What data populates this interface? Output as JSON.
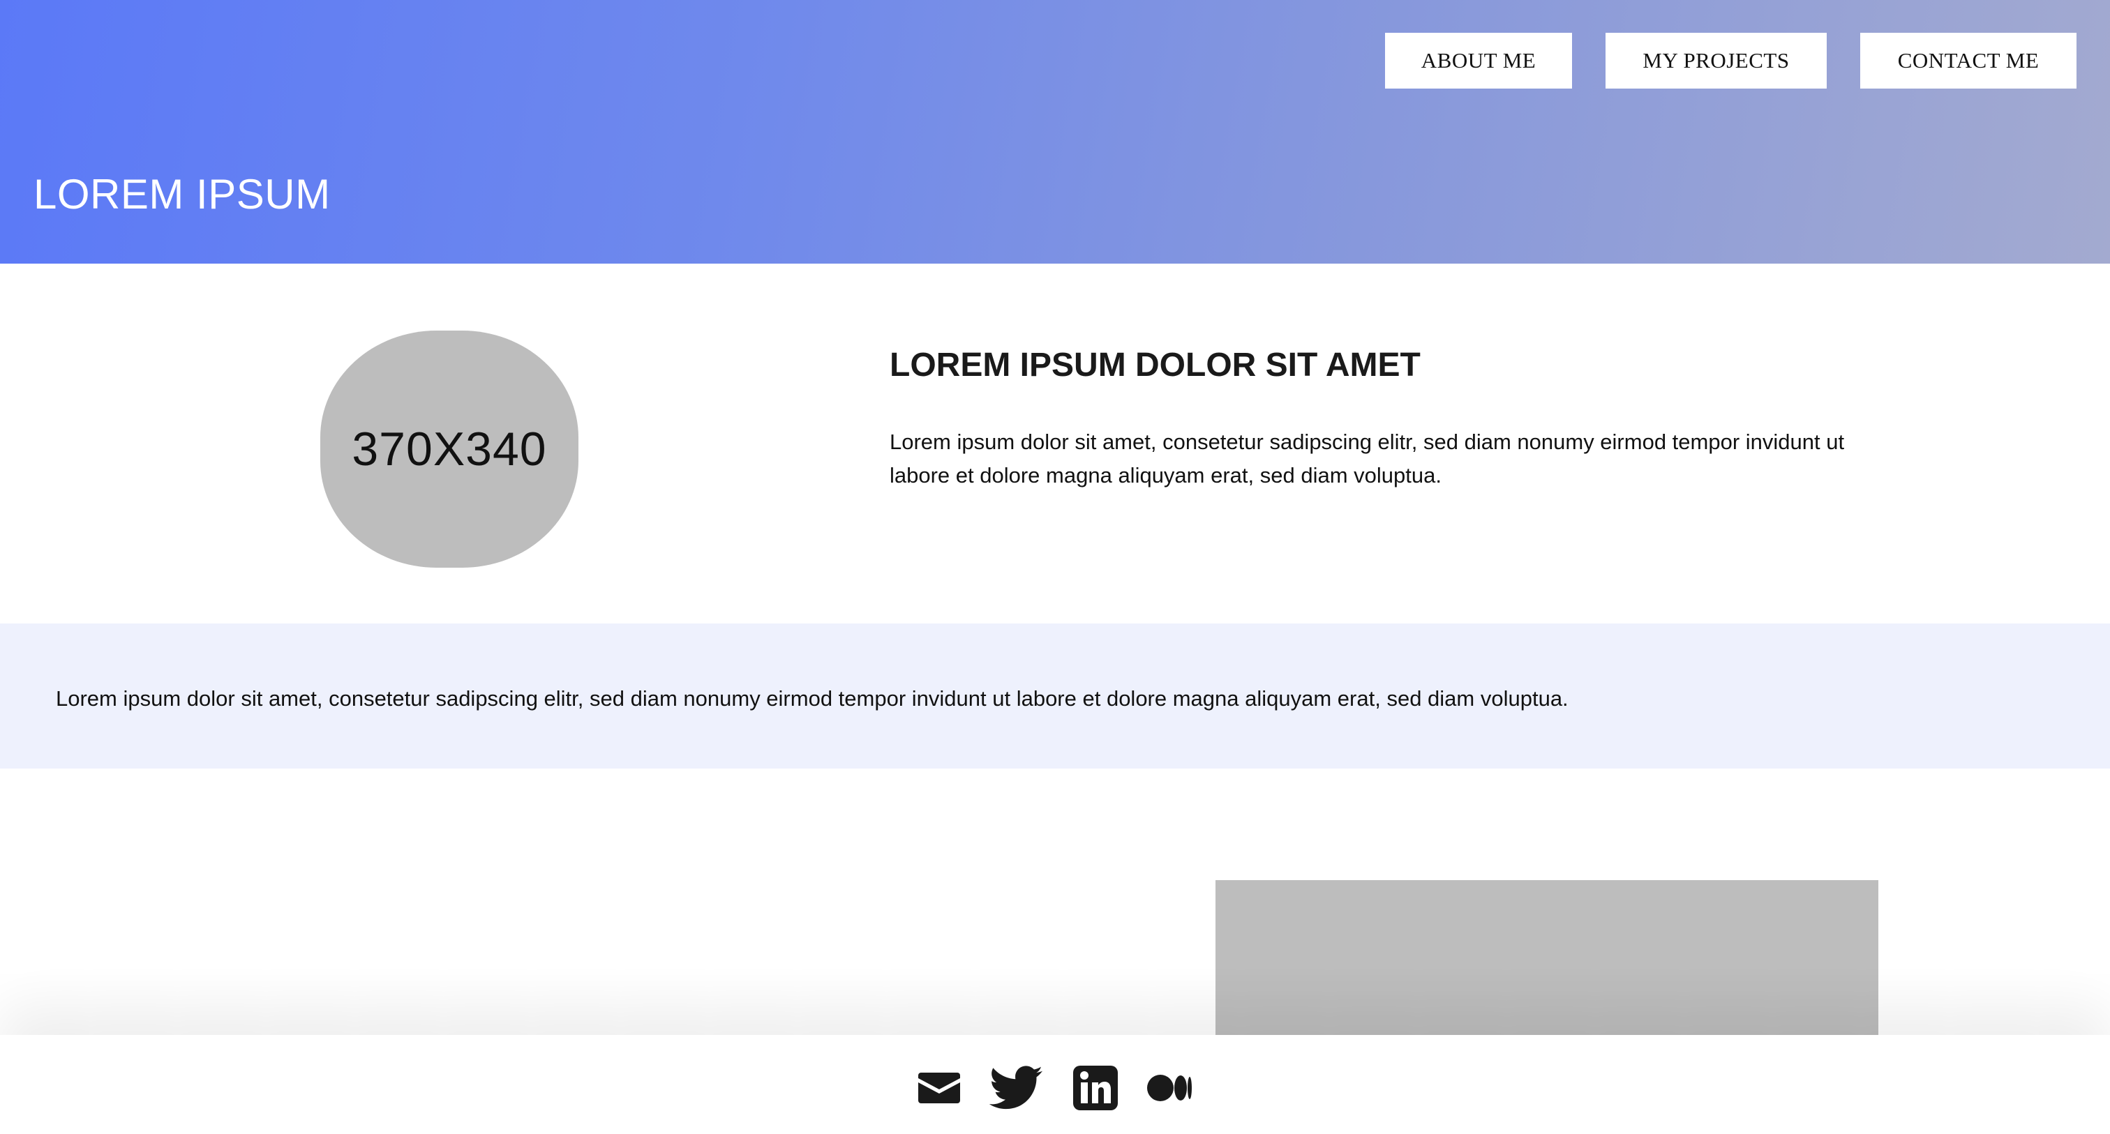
{
  "header": {
    "title": "LOREM IPSUM",
    "nav": {
      "about": "ABOUT ME",
      "projects": "MY PROJECTS",
      "contact": "CONTACT ME"
    },
    "gradient_colors": [
      "#5b79f7",
      "#a3aad0"
    ]
  },
  "intro": {
    "avatar_placeholder": "370X340",
    "heading": "LOREM IPSUM DOLOR SIT AMET",
    "text": "Lorem ipsum dolor sit amet, consetetur sadipscing elitr, sed diam nonumy eirmod tempor invidunt ut labore et dolore magna aliquyam erat, sed diam voluptua."
  },
  "band": {
    "text": "Lorem ipsum dolor sit amet, consetetur sadipscing elitr, sed diam nonumy eirmod tempor invidunt ut labore et dolore magna aliquyam erat, sed diam voluptua.",
    "background": "#eef1fd"
  },
  "footer": {
    "icons": [
      "email-icon",
      "twitter-icon",
      "linkedin-icon",
      "medium-icon"
    ]
  },
  "colors": {
    "placeholder_gray": "#bdbdbd",
    "icon_color": "#1a1a1a"
  }
}
